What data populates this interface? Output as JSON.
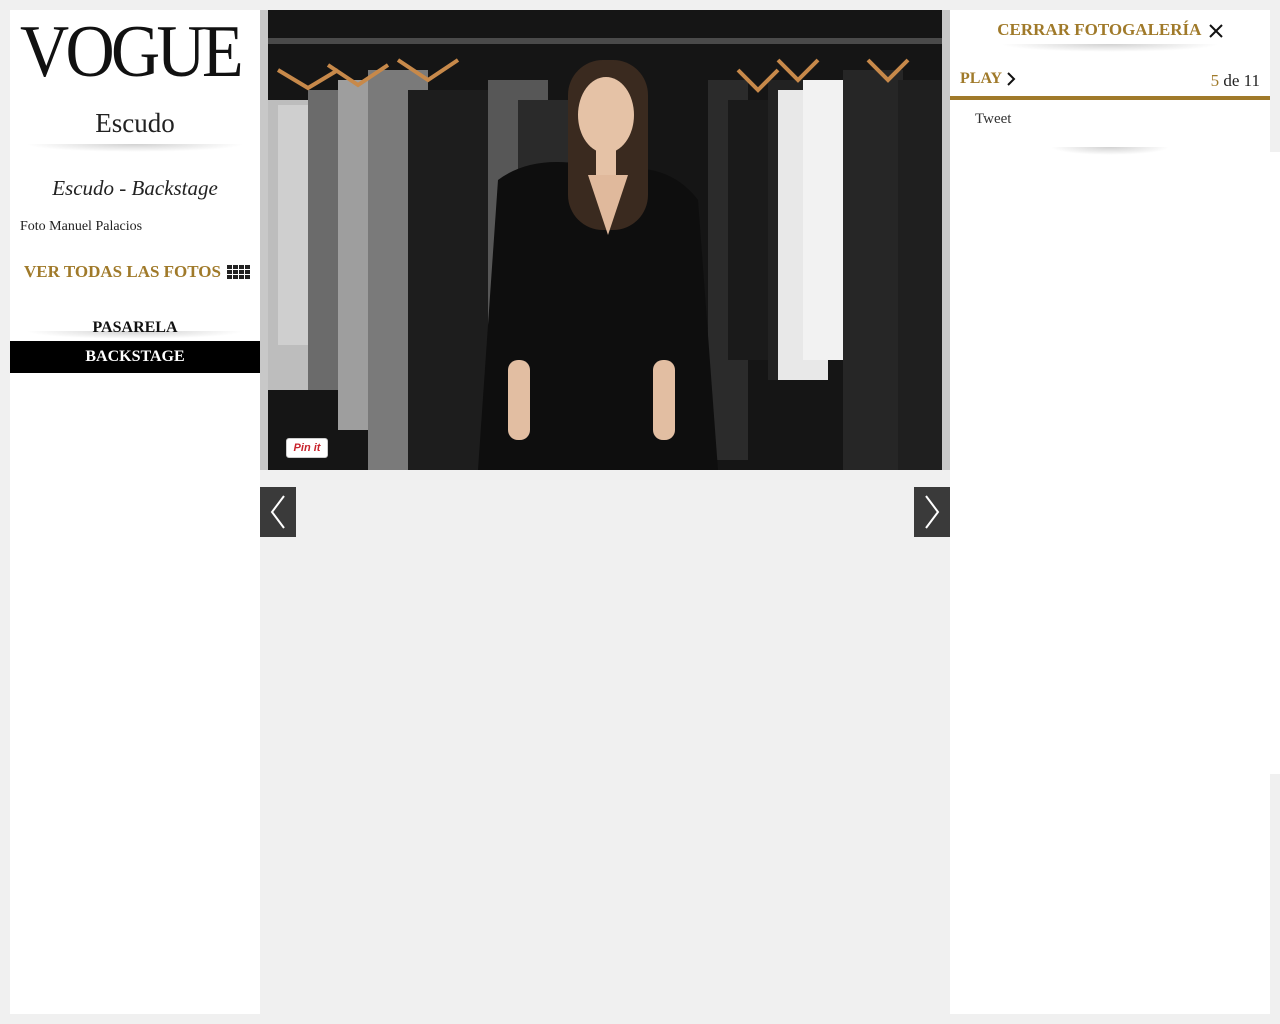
{
  "sidebar": {
    "logo": "VOGUE",
    "brand": "Escudo",
    "gallery_title": "Escudo - Backstage",
    "credit": "Foto Manuel Palacios",
    "see_all_label": "VER TODAS LAS FOTOS",
    "tabs": [
      {
        "label": "PASARELA",
        "active": false
      },
      {
        "label": "BACKSTAGE",
        "active": true
      }
    ]
  },
  "gallery": {
    "pin_label": "Pin it",
    "photo_icon": "backstage-photo"
  },
  "panel": {
    "close_label": "CERRAR FOTOGALERÍA",
    "play_label": "PLAY",
    "current": "5",
    "of_label": "de",
    "total": "11",
    "tweet_label": "Tweet"
  },
  "colors": {
    "accent": "#a07a2a",
    "background": "#f0f0f0",
    "active_tab": "#000000"
  }
}
